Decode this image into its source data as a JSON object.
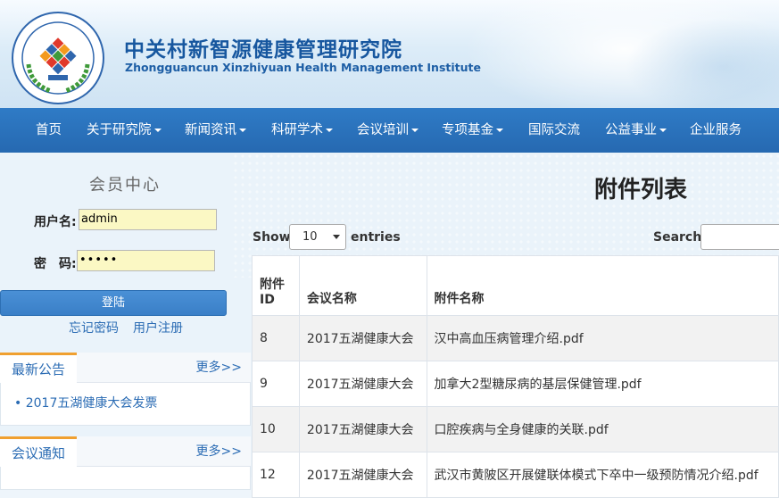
{
  "header": {
    "title_cn": "中关村新智源健康管理研究院",
    "title_en": "Zhongguancun Xinzhiyuan Health Management Institute",
    "logo_icon": "institute-seal-logo-icon"
  },
  "nav": {
    "items": [
      {
        "label": "首页",
        "dropdown": false
      },
      {
        "label": "关于研究院",
        "dropdown": true
      },
      {
        "label": "新闻资讯",
        "dropdown": true
      },
      {
        "label": "科研学术",
        "dropdown": true
      },
      {
        "label": "会议培训",
        "dropdown": true
      },
      {
        "label": "专项基金",
        "dropdown": true
      },
      {
        "label": "国际交流",
        "dropdown": false
      },
      {
        "label": "公益事业",
        "dropdown": true
      },
      {
        "label": "企业服务",
        "dropdown": false
      }
    ]
  },
  "member": {
    "title": "会员中心",
    "username_label": "用户名:",
    "username_value": "admin",
    "password_label": "密　码:",
    "password_value": "•••••",
    "login_label": "登陆",
    "forgot_label": "忘记密码",
    "register_label": "用户注册"
  },
  "announcements": {
    "tab": "最新公告",
    "more": "更多>>",
    "items": [
      "2017五湖健康大会发票"
    ]
  },
  "meetings": {
    "tab": "会议通知",
    "more": "更多>>"
  },
  "main": {
    "title": "附件列表",
    "show_label": "Show",
    "entries_value": "10",
    "entries_label": "entries",
    "search_label": "Search:",
    "columns": [
      "附件ID",
      "会议名称",
      "附件名称"
    ],
    "col_id_line1": "附件",
    "col_id_line2": "ID",
    "rows": [
      {
        "id": "8",
        "meeting": "2017五湖健康大会",
        "file": "汉中高血压病管理介绍.pdf"
      },
      {
        "id": "9",
        "meeting": "2017五湖健康大会",
        "file": "加拿大2型糖尿病的基层保健管理.pdf"
      },
      {
        "id": "10",
        "meeting": "2017五湖健康大会",
        "file": "口腔疾病与全身健康的关联.pdf"
      },
      {
        "id": "12",
        "meeting": "2017五湖健康大会",
        "file": "武汉市黄陂区开展健联体模式下卒中一级预防情况介绍.pdf"
      }
    ]
  },
  "colors": {
    "nav_bg": "#2a70b8",
    "title_blue": "#17579f",
    "link_blue": "#2b6cb4",
    "tab_accent": "#f0a030",
    "input_bg": "#fbf8c4"
  }
}
